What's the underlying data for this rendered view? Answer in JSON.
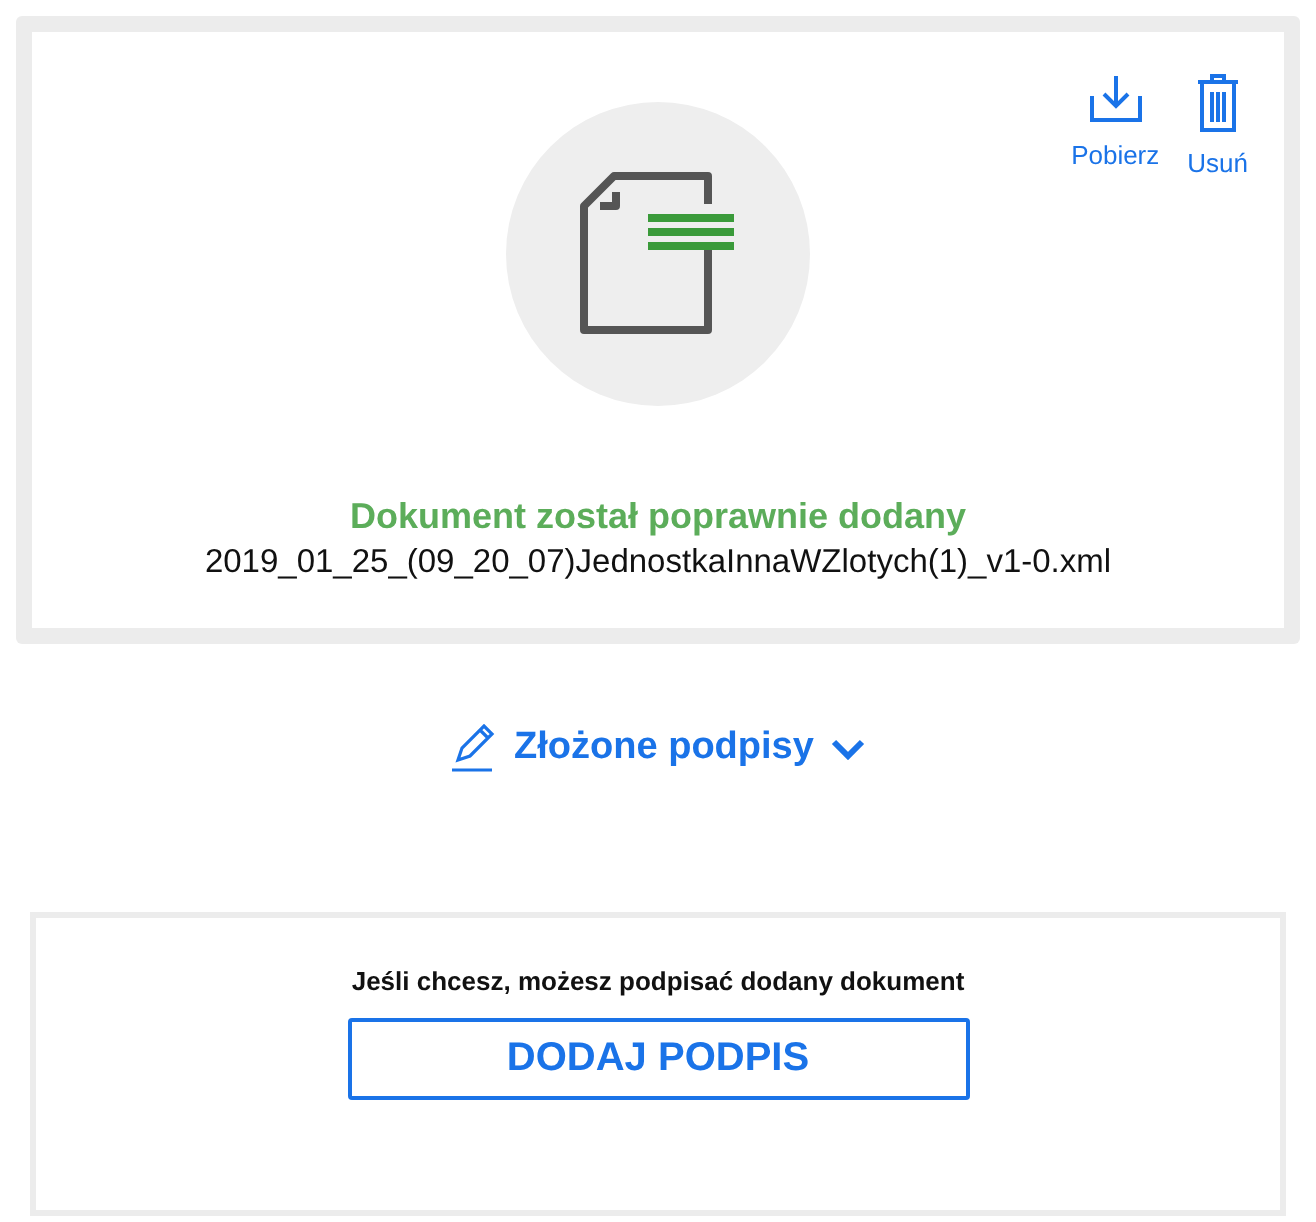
{
  "document": {
    "actions": [
      {
        "kind": "download",
        "label": "Pobierz"
      },
      {
        "kind": "delete",
        "label": "Usuń"
      }
    ],
    "status": "Dokument został poprawnie dodany",
    "filename": "2019_01_25_(09_20_07)JednostkaInnaWZlotych(1)_v1-0.xml"
  },
  "signatures": {
    "label": "Złożone podpisy",
    "expanded": false
  },
  "sign_panel": {
    "prompt": "Jeśli chcesz, możesz podpisać dodany dokument",
    "button": "DODAJ PODPIS"
  }
}
